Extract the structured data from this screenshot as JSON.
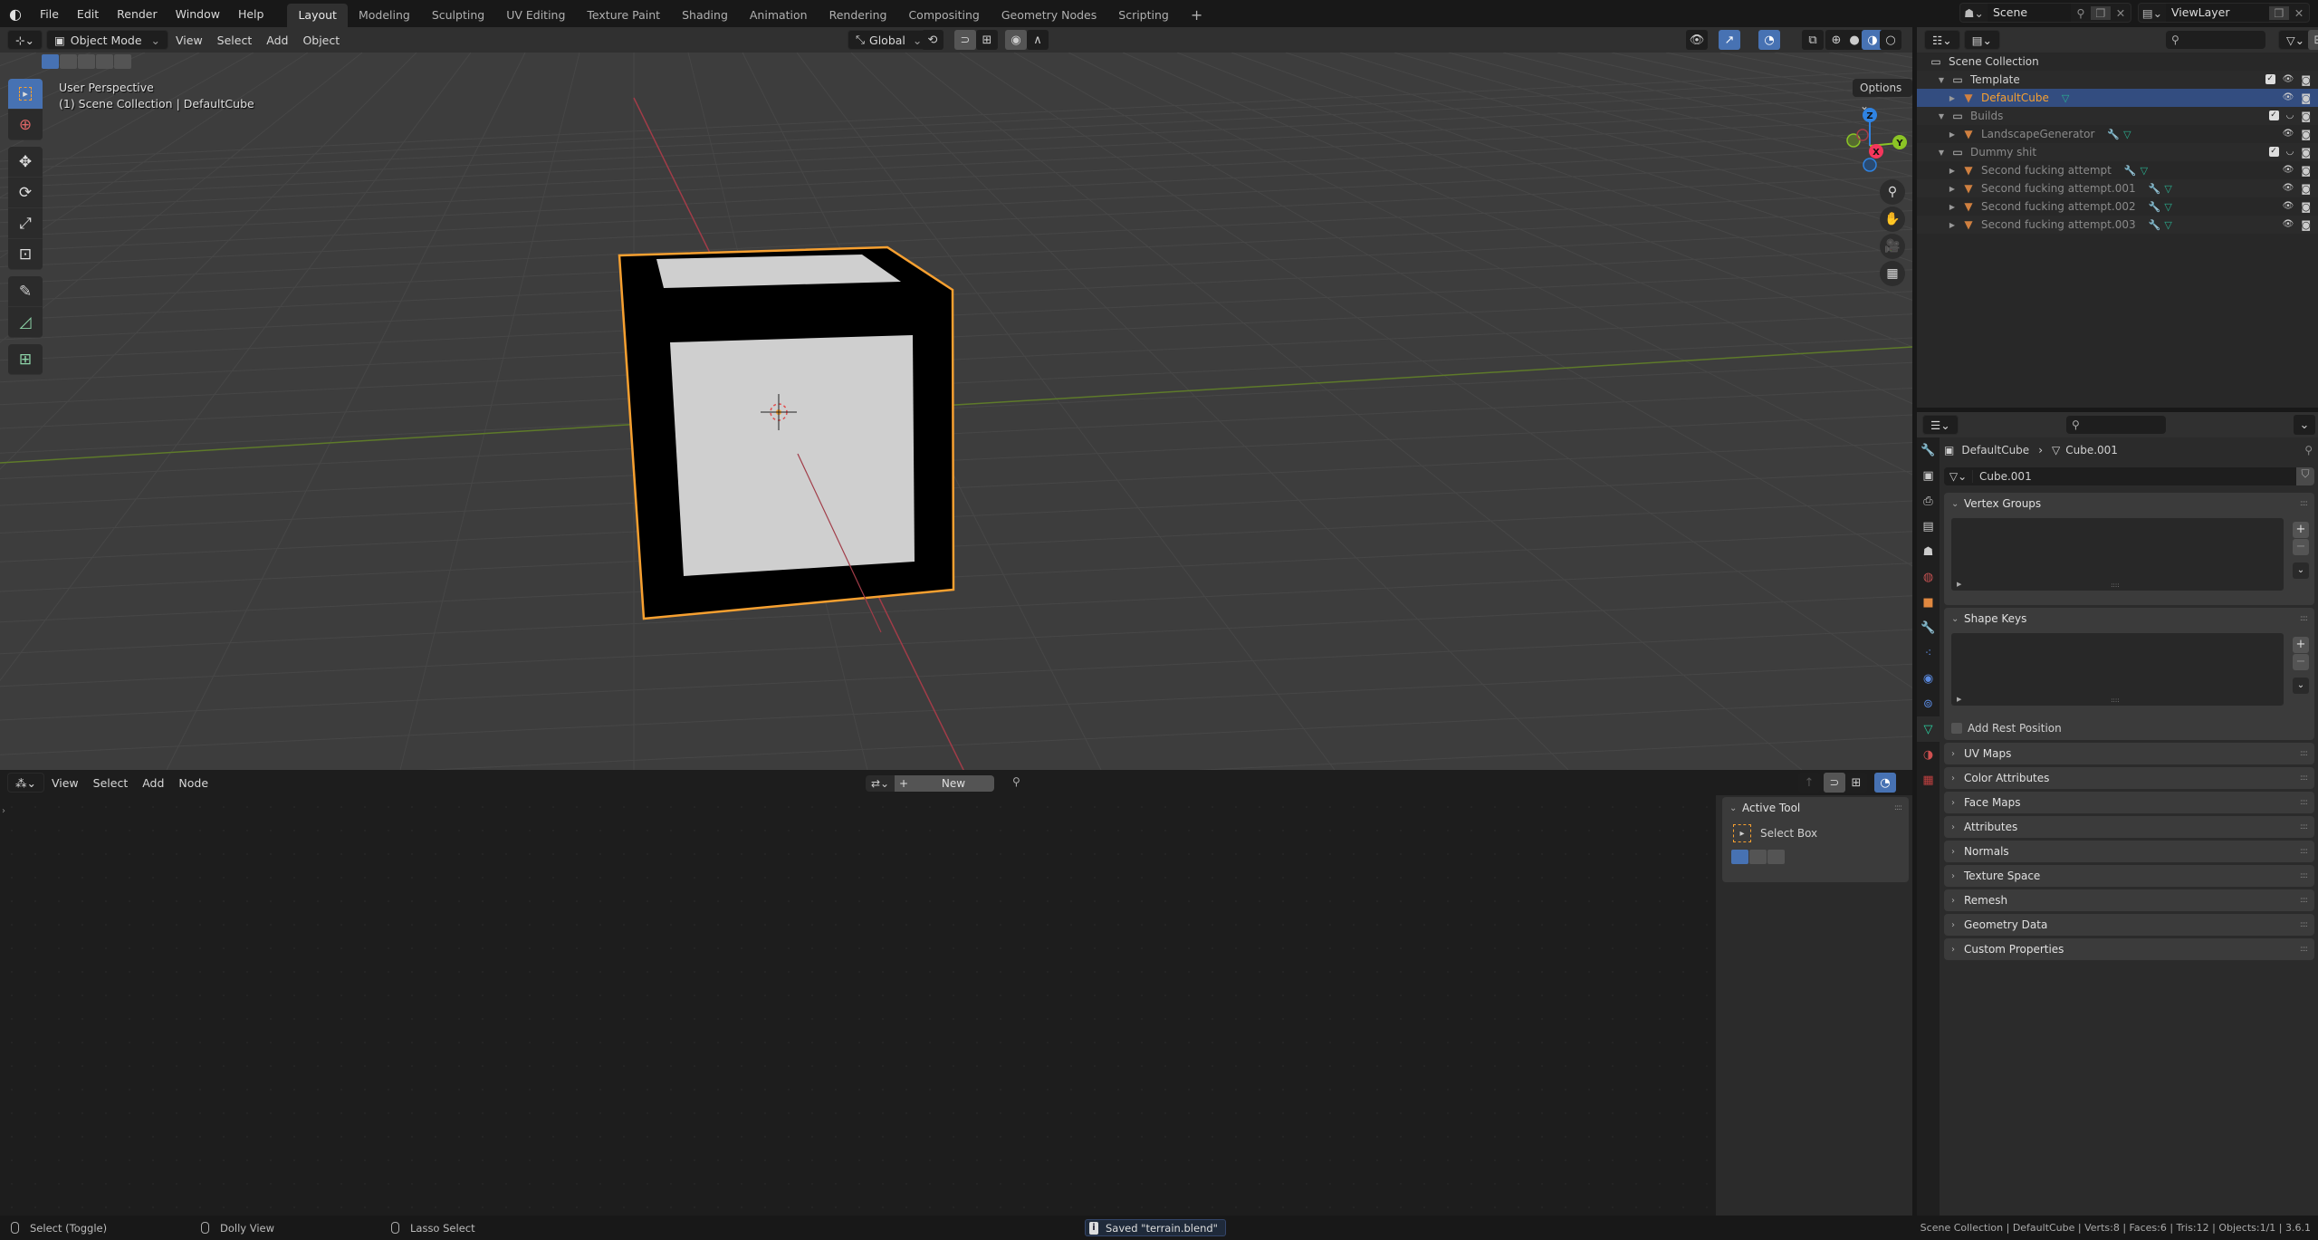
{
  "topbar": {
    "menus": [
      "File",
      "Edit",
      "Render",
      "Window",
      "Help"
    ],
    "workspaces": [
      "Layout",
      "Modeling",
      "Sculpting",
      "UV Editing",
      "Texture Paint",
      "Shading",
      "Animation",
      "Rendering",
      "Compositing",
      "Geometry Nodes",
      "Scripting"
    ],
    "active_workspace": "Layout",
    "add_workspace": "+",
    "scene": "Scene",
    "view_layer": "ViewLayer"
  },
  "viewport": {
    "mode": "Object Mode",
    "menus": [
      "View",
      "Select",
      "Add",
      "Object"
    ],
    "orientation": "Global",
    "info_line1": "User Perspective",
    "info_line2": "(1) Scene Collection | DefaultCube",
    "options_label": "Options",
    "gizmo_axes": {
      "x": "X",
      "y": "Y",
      "z": "Z"
    },
    "colors": {
      "x": "#f5365c",
      "y": "#8bc425",
      "z": "#2f83e2",
      "selection": "#f7a030",
      "header": "#303030",
      "bg": "#3d3d3d"
    }
  },
  "tools": [
    "select-box",
    "cursor",
    "move",
    "rotate",
    "scale",
    "transform",
    "annotate",
    "measure",
    "add-cube"
  ],
  "node_editor": {
    "menus": [
      "View",
      "Select",
      "Add",
      "Node"
    ],
    "new_label": "New",
    "active_tool_title": "Active Tool",
    "active_tool_name": "Select Box"
  },
  "outliner": {
    "root": "Scene Collection",
    "rows": [
      {
        "name": "Template",
        "type": "collection",
        "level": 0,
        "checked": true,
        "visible": true
      },
      {
        "name": "DefaultCube",
        "type": "object",
        "level": 1,
        "selected": true,
        "modifier": false,
        "mesh": true
      },
      {
        "name": "Builds",
        "type": "collection",
        "level": 0,
        "checked": true,
        "visible": false
      },
      {
        "name": "LandscapeGenerator",
        "type": "object",
        "level": 1,
        "modifier": true,
        "mesh": true
      },
      {
        "name": "Dummy shit",
        "type": "collection",
        "level": 0,
        "checked": true,
        "visible": false
      },
      {
        "name": "Second fucking attempt",
        "type": "object",
        "level": 1,
        "modifier": true,
        "mesh": true
      },
      {
        "name": "Second fucking attempt.001",
        "type": "object",
        "level": 1,
        "modifier": true,
        "mesh": true
      },
      {
        "name": "Second fucking attempt.002",
        "type": "object",
        "level": 1,
        "modifier": true,
        "mesh": true
      },
      {
        "name": "Second fucking attempt.003",
        "type": "object",
        "level": 1,
        "modifier": true,
        "mesh": true
      }
    ]
  },
  "properties": {
    "breadcrumb_object": "DefaultCube",
    "breadcrumb_data": "Cube.001",
    "data_name": "Cube.001",
    "panels_open": [
      {
        "title": "Vertex Groups"
      },
      {
        "title": "Shape Keys",
        "checkbox": "Add Rest Position"
      }
    ],
    "panels_closed": [
      "UV Maps",
      "Color Attributes",
      "Face Maps",
      "Attributes",
      "Normals",
      "Texture Space",
      "Remesh",
      "Geometry Data",
      "Custom Properties"
    ]
  },
  "statusbar": {
    "left": [
      "Select (Toggle)",
      "Dolly View",
      "Lasso Select"
    ],
    "message": "Saved \"terrain.blend\"",
    "right": "Scene Collection | DefaultCube | Verts:8 | Faces:6 | Tris:12 | Objects:1/1 | 3.6.1"
  }
}
